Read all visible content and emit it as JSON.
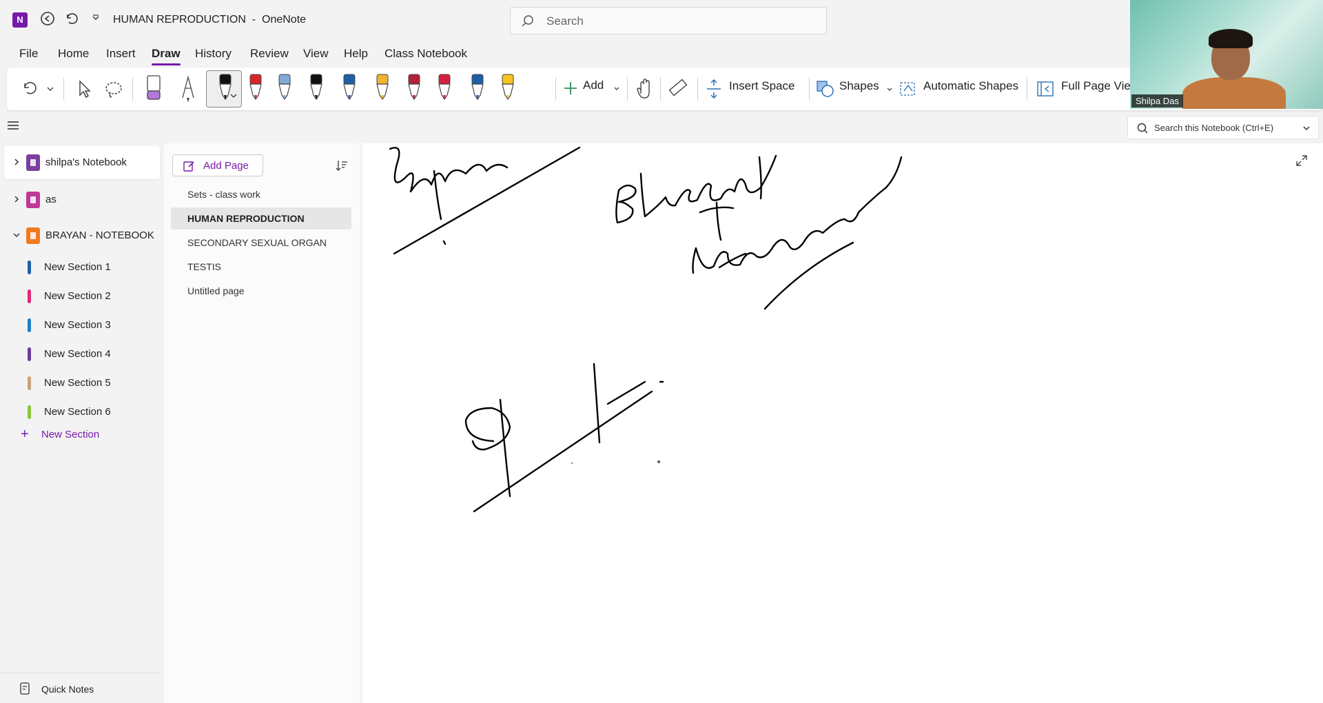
{
  "app": {
    "logo_letter": "N",
    "title": "HUMAN REPRODUCTION  -  OneNote",
    "search_placeholder": "Search"
  },
  "ribbon_tabs": [
    {
      "label": "File"
    },
    {
      "label": "Home"
    },
    {
      "label": "Insert"
    },
    {
      "label": "Draw",
      "active": true
    },
    {
      "label": "History"
    },
    {
      "label": "Review"
    },
    {
      "label": "View"
    },
    {
      "label": "Help"
    },
    {
      "label": "Class Notebook"
    }
  ],
  "toolbar": {
    "add_label": "Add",
    "insert_space_label": "Insert Space",
    "shapes_label": "Shapes",
    "automatic_shapes_label": "Automatic Shapes",
    "full_page_view_label": "Full Page View",
    "pens": [
      {
        "color": "#b279d6"
      },
      {
        "color": "#ffffff"
      },
      {
        "color": "#111111"
      },
      {
        "color": "#d6262b"
      },
      {
        "color": "#7fa9d8"
      },
      {
        "color": "#111111"
      },
      {
        "color": "#1f5fa8"
      },
      {
        "color": "#f2b233"
      },
      {
        "color": "#b51f3a"
      },
      {
        "color": "#d61f3e"
      },
      {
        "color": "#1f5fa8"
      },
      {
        "color": "#f7c41f"
      }
    ]
  },
  "video": {
    "participant_name": "Shilpa Das"
  },
  "notebook_search": {
    "placeholder": "Search this Notebook (Ctrl+E)"
  },
  "notebooks": [
    {
      "label": "shilpa's Notebook",
      "color": "#7b3fa0",
      "expanded": false
    },
    {
      "label": "as",
      "color": "#c0389a",
      "expanded": false
    },
    {
      "label": "BRAYAN - NOTEBOOK",
      "color": "#f07a22",
      "expanded": true
    }
  ],
  "sections": [
    {
      "label": "New Section 1",
      "color": "#1f5fa8"
    },
    {
      "label": "New Section 2",
      "color": "#e0287a"
    },
    {
      "label": "New Section 3",
      "color": "#1f7fc4"
    },
    {
      "label": "New Section 4",
      "color": "#6a3aa0"
    },
    {
      "label": "New Section 5",
      "color": "#c9a27a"
    },
    {
      "label": "New Section 6",
      "color": "#8cc63f"
    }
  ],
  "new_section_label": "New Section",
  "quick_notes_label": "Quick Notes",
  "add_page_label": "Add Page",
  "pages": [
    {
      "label": "Sets - class work",
      "active": false
    },
    {
      "label": "HUMAN REPRODUCTION",
      "active": true
    },
    {
      "label": "SECONDARY SEXUAL ORGAN",
      "active": false
    },
    {
      "label": "TESTIS",
      "active": false
    },
    {
      "label": "Untitled page",
      "active": false
    }
  ],
  "accent_color": "#7719aa"
}
